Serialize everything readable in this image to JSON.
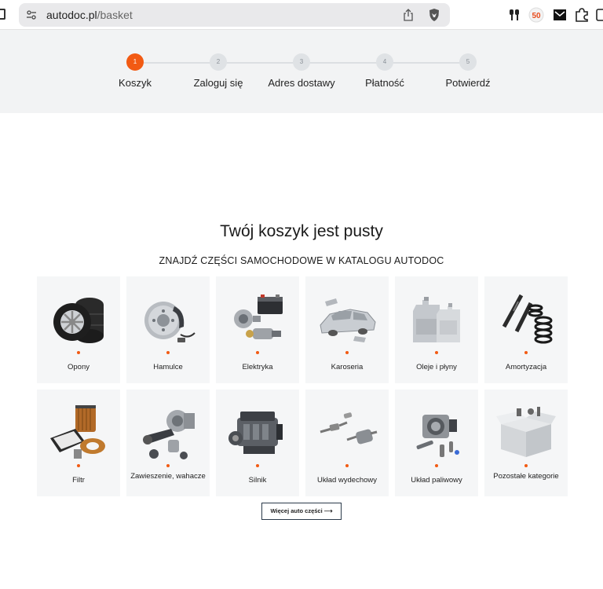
{
  "browser": {
    "url_host": "autodoc.pl",
    "url_path": "/basket"
  },
  "stepper": {
    "steps": [
      {
        "number": "1",
        "label": "Koszyk",
        "active": true
      },
      {
        "number": "2",
        "label": "Zaloguj się",
        "active": false
      },
      {
        "number": "3",
        "label": "Adres dostawy",
        "active": false
      },
      {
        "number": "4",
        "label": "Płatność",
        "active": false
      },
      {
        "number": "5",
        "label": "Potwierdź",
        "active": false
      }
    ]
  },
  "main": {
    "title": "Twój koszyk jest pusty",
    "subtitle": "ZNAJDŹ CZĘŚCI SAMOCHODOWE W KATALOGU AUTODOC",
    "categories": [
      {
        "label": "Opony",
        "icon": "tires-icon"
      },
      {
        "label": "Hamulce",
        "icon": "brakes-icon"
      },
      {
        "label": "Elektryka",
        "icon": "electrics-icon"
      },
      {
        "label": "Karoseria",
        "icon": "body-icon"
      },
      {
        "label": "Oleje i płyny",
        "icon": "oil-icon"
      },
      {
        "label": "Amortyzacja",
        "icon": "shock-absorber-icon"
      },
      {
        "label": "Filtr",
        "icon": "filter-icon"
      },
      {
        "label": "Zawieszenie, wahacze",
        "icon": "suspension-icon"
      },
      {
        "label": "Silnik",
        "icon": "engine-icon"
      },
      {
        "label": "Układ wydechowy",
        "icon": "exhaust-icon"
      },
      {
        "label": "Układ paliwowy",
        "icon": "fuel-system-icon"
      },
      {
        "label": "Pozostałe kategorie",
        "icon": "box-icon"
      }
    ],
    "more_button": "Więcej auto części ⟶"
  },
  "colors": {
    "accent": "#f25a13",
    "stepper_bg": "#f2f3f4",
    "card_bg": "#f5f6f7"
  }
}
